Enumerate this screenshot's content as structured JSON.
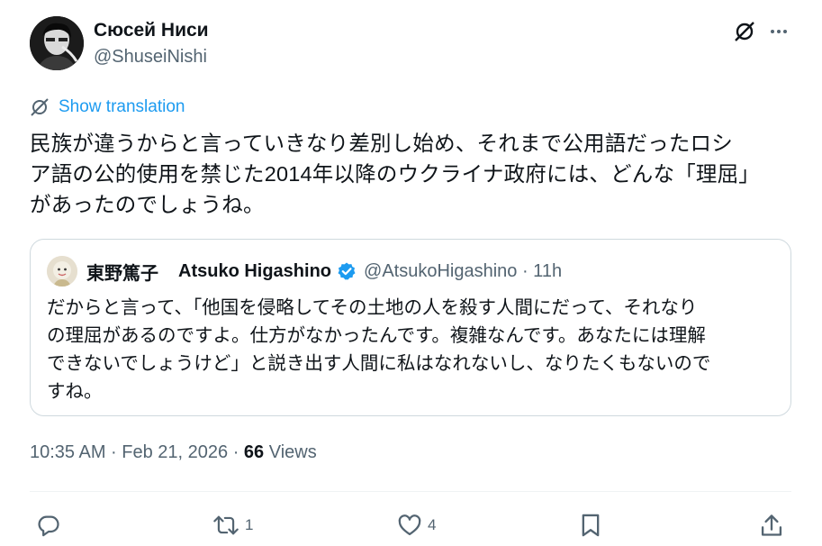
{
  "author": {
    "name": "Сюсей Ниси",
    "handle": "@ShuseiNishi"
  },
  "translate_label": "Show translation",
  "post": {
    "lines": [
      "民族が違うからと言っていきなり差別し始め、それまで公用語だったロシ",
      "ア語の公的使用を禁じた2014年以降のウクライナ政府には、どんな「理屈」",
      "があったのでしょうね。"
    ]
  },
  "quote": {
    "name_jp": "東野篤子",
    "name_en": "Atsuko Higashino",
    "handle_time": "@AtsukoHigashino · 11h",
    "lines": [
      "だからと言って、「他国を侵略してその土地の人を殺す人間にだって、それなり",
      "の理屈があるのですよ。仕方がなかったんです。複雑なんです。あなたには理解",
      "できないでしょうけど」と説き出す人間に私はなれないし、なりたくもないので",
      "すね。"
    ]
  },
  "meta": {
    "timestamp": "10:35 AM · Feb 21, 2026 · ",
    "views_count": "66",
    "views_label": " Views"
  },
  "actions": {
    "reposts": "1",
    "likes": "4"
  },
  "colors": {
    "accent": "#1d9bf0",
    "muted": "#536471",
    "text": "#0f1419",
    "border": "#cfd9de"
  },
  "icons": [
    "grok-icon",
    "more-icon",
    "translate-icon",
    "verified-icon",
    "reply-icon",
    "repost-icon",
    "like-icon",
    "bookmark-icon",
    "share-icon"
  ]
}
